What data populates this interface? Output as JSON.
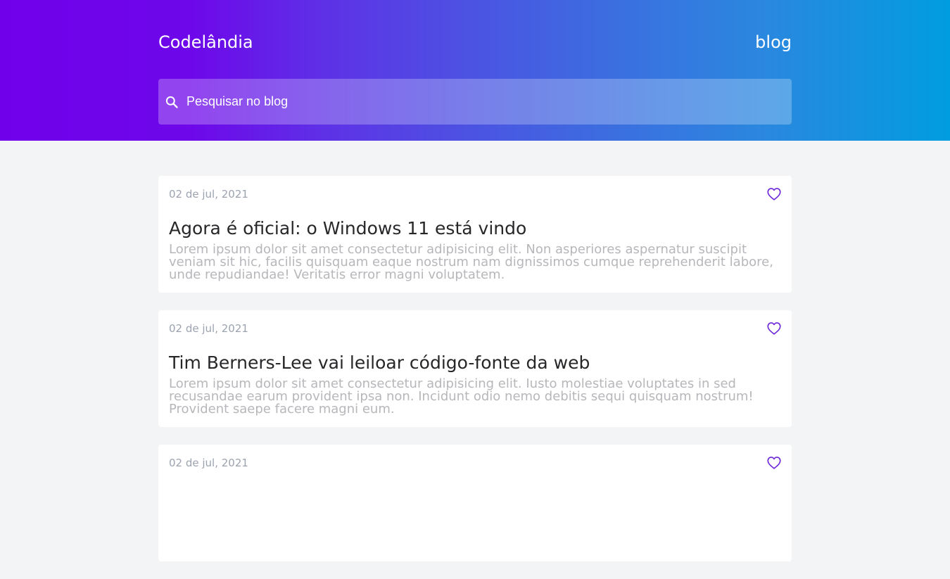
{
  "header": {
    "logo": "Codelândia",
    "nav_link": "blog",
    "search": {
      "placeholder": "Pesquisar no blog",
      "value": ""
    }
  },
  "posts": [
    {
      "date": "02 de jul, 2021",
      "title": "Agora é oficial: o Windows 11 está vindo",
      "body": "Lorem ipsum dolor sit amet consectetur adipisicing elit. Non asperiores aspernatur suscipit veniam sit hic, facilis quisquam eaque nostrum nam dignissimos cumque reprehenderit labore, unde repudiandae! Veritatis error magni voluptatem."
    },
    {
      "date": "02 de jul, 2021",
      "title": "Tim Berners-Lee vai leiloar código-fonte da web",
      "body": "Lorem ipsum dolor sit amet consectetur adipisicing elit. Iusto molestiae voluptates in sed recusandae earum provident ipsa non. Incidunt odio nemo debitis sequi quisquam nostrum! Provident saepe facere magni eum."
    },
    {
      "date": "02 de jul, 2021",
      "title": "",
      "body": ""
    }
  ],
  "colors": {
    "accent": "#6d28d9",
    "gradient_start": "#7000ea",
    "gradient_end": "#009ddf"
  }
}
